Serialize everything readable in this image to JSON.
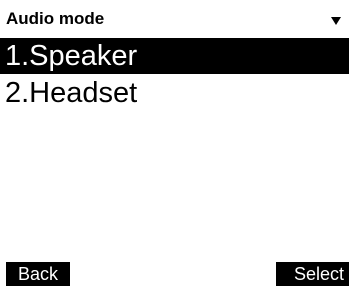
{
  "header": {
    "title": "Audio mode",
    "dropdown_icon": "chevron-down-icon"
  },
  "menu": {
    "selected_index": 0,
    "items": [
      {
        "label": "1.Speaker"
      },
      {
        "label": "2.Headset"
      }
    ]
  },
  "softkeys": {
    "left_label": "Back",
    "right_label": "Select"
  },
  "colors": {
    "background": "#ffffff",
    "foreground": "#000000",
    "highlight_background": "#000000",
    "highlight_text": "#ffffff"
  }
}
